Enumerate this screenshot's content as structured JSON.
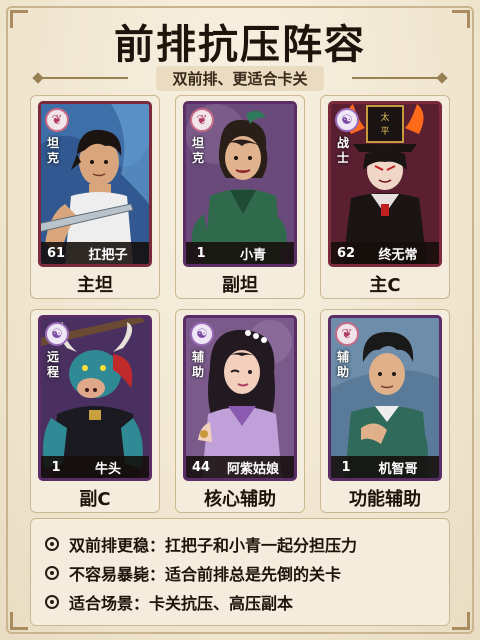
{
  "header": {
    "title": "前排抗压阵容",
    "subtitle": "双前排、更适合卡关"
  },
  "lineup": [
    {
      "role": "坦克",
      "level": "61",
      "name": "扛把子",
      "position_label": "主坦",
      "rarity_color": "purple",
      "badge_icon": "feather-icon"
    },
    {
      "role": "坦克",
      "level": "1",
      "name": "小青",
      "position_label": "副坦",
      "rarity_color": "purple",
      "badge_icon": "feather-icon"
    },
    {
      "role": "战士",
      "level": "62",
      "name": "终无常",
      "position_label": "主C",
      "rarity_color": "red",
      "badge_icon": "ghost-icon",
      "hat_text": "太平"
    },
    {
      "role": "远程",
      "level": "1",
      "name": "牛头",
      "position_label": "副C",
      "rarity_color": "red",
      "badge_icon": "ghost-icon"
    },
    {
      "role": "辅助",
      "level": "44",
      "name": "阿紫姑娘",
      "position_label": "核心辅助",
      "rarity_color": "purple",
      "badge_icon": "ghost-icon"
    },
    {
      "role": "辅助",
      "level": "1",
      "name": "机智哥",
      "position_label": "功能辅助",
      "rarity_color": "purple",
      "badge_icon": "feather-icon"
    }
  ],
  "notes": [
    "双前排更稳：扛把子和小青一起分担压力",
    "不容易暴毙：适合前排总是先倒的关卡",
    "适合场景：卡关抗压、高压副本"
  ],
  "colors": {
    "background": "#f3ead8",
    "purple_card": "#5a2d66",
    "red_card": "#7b2a3d",
    "text": "#1e140c"
  }
}
